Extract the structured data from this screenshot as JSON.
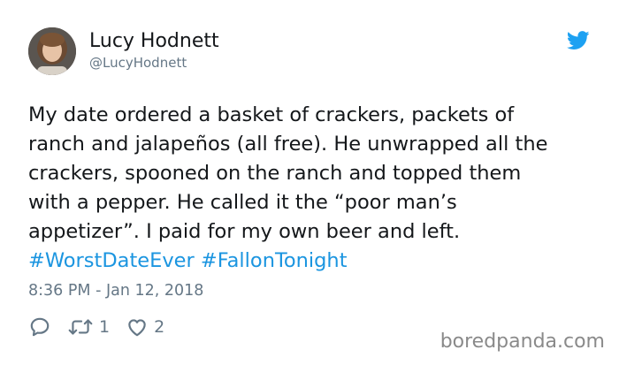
{
  "author": {
    "display_name": "Lucy Hodnett",
    "handle": "@LucyHodnett",
    "avatar_icon": "profile-photo"
  },
  "tweet": {
    "lines": [
      "My date ordered a basket of crackers, packets of",
      "ranch and jalapeños (all free). He unwrapped all the",
      "crackers, spooned on the ranch and topped them",
      "with a pepper.  He called it the “poor man’s",
      "appetizer”.  I paid for my own beer and left."
    ],
    "hashtags": [
      "#WorstDateEver",
      "#FallonTonight"
    ],
    "timestamp": "8:36 PM - Jan 12, 2018"
  },
  "actions": {
    "reply_icon": "speech-bubble-icon",
    "retweet_icon": "retweet-icon",
    "retweet_count": "1",
    "like_icon": "heart-icon",
    "like_count": "2"
  },
  "brand": {
    "icon": "twitter-bird-icon",
    "color": "#1da1f2"
  },
  "colors": {
    "hashtag": "#1b95e0",
    "secondary_text": "#657786",
    "primary_text": "#14171a"
  },
  "watermark": "boredpanda.com"
}
